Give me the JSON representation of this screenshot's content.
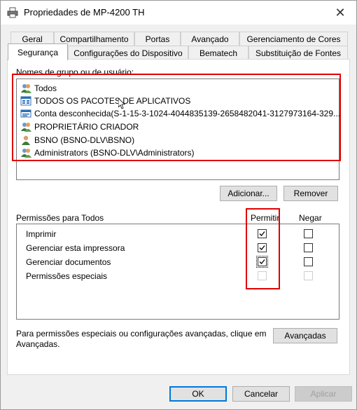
{
  "window": {
    "title": "Propriedades de MP-4200 TH",
    "close_glyph": "✕"
  },
  "tabs_back": [
    "Geral",
    "Compartilhamento",
    "Portas",
    "Avançado",
    "Gerenciamento de Cores"
  ],
  "tabs_front": [
    "Segurança",
    "Configurações do Dispositivo",
    "Bematech",
    "Substituição de Fontes"
  ],
  "active_tab": "Segurança",
  "groups": {
    "label": "Nomes de grupo ou de usuário:",
    "items": [
      {
        "name": "Todos",
        "icon": "group-icon"
      },
      {
        "name": "TODOS OS PACOTES DE APLICATIVOS",
        "icon": "app-packages-icon"
      },
      {
        "name": "Conta desconhecida(S-1-15-3-1024-4044835139-2658482041-3127973164-329...",
        "icon": "unknown-account-icon"
      },
      {
        "name": "PROPRIETÁRIO CRIADOR",
        "icon": "group-icon"
      },
      {
        "name": "BSNO (BSNO-DLV\\BSNO)",
        "icon": "user-icon"
      },
      {
        "name": "Administrators (BSNO-DLV\\Administrators)",
        "icon": "group-icon"
      }
    ]
  },
  "buttons": {
    "add": "Adicionar...",
    "remove": "Remover",
    "advanced": "Avançadas",
    "ok": "OK",
    "cancel": "Cancelar",
    "apply": "Aplicar"
  },
  "permissions": {
    "label": "Permissões para Todos",
    "col_allow": "Permitir",
    "col_deny": "Negar",
    "rows": [
      {
        "name": "Imprimir",
        "allow": true,
        "deny": false
      },
      {
        "name": "Gerenciar esta impressora",
        "allow": true,
        "deny": false
      },
      {
        "name": "Gerenciar documentos",
        "allow": true,
        "deny": false
      },
      {
        "name": "Permissões especiais",
        "allow": false,
        "deny": false,
        "disabled": true
      }
    ]
  },
  "footer_text_line1": "Para permissões especiais ou configurações avançadas, clique em",
  "footer_text_line2": "Avançadas.",
  "colors": {
    "highlight": "#e00000",
    "accent": "#0078d7"
  }
}
